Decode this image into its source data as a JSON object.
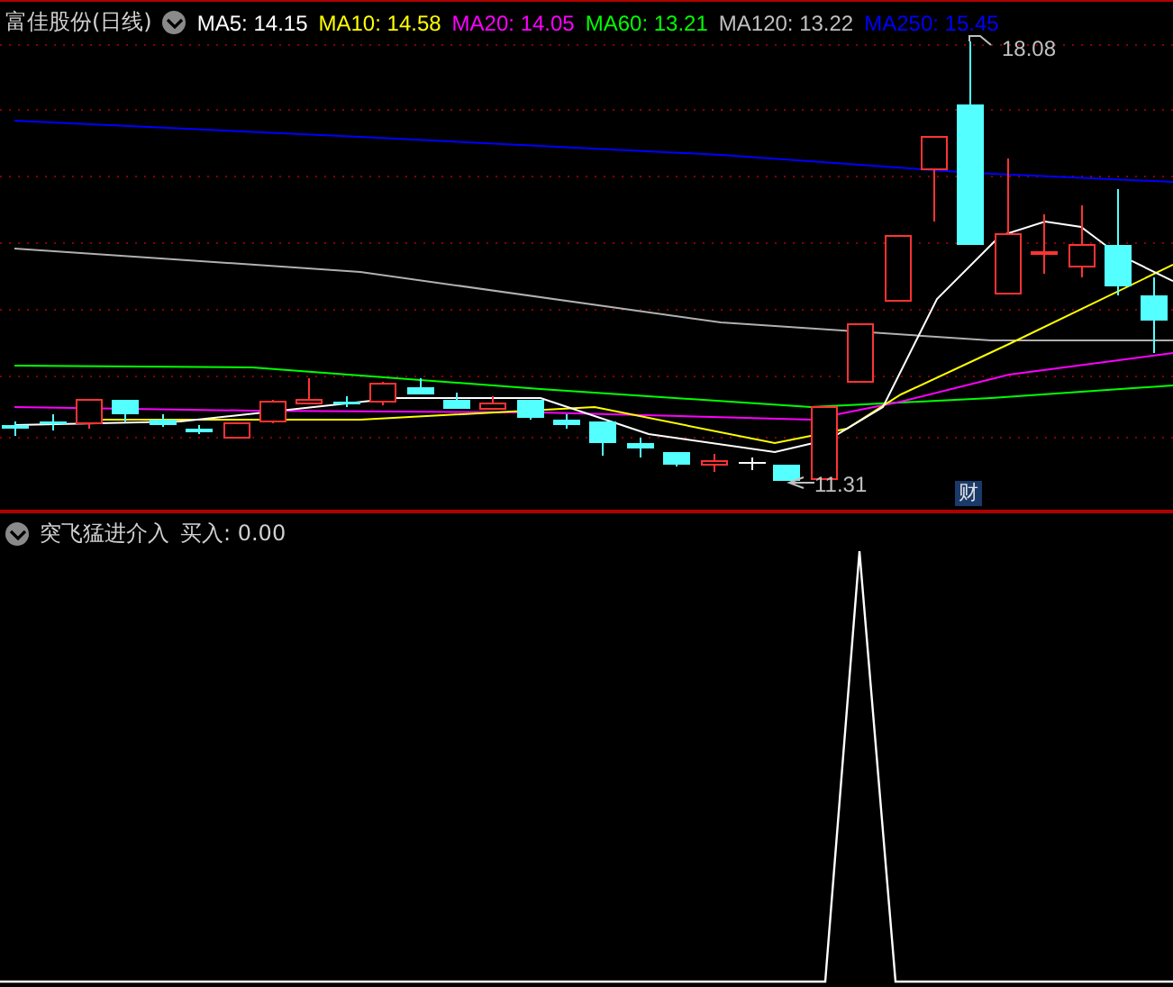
{
  "main_chart": {
    "title": "富佳股份(日线)",
    "moving_averages": [
      {
        "label": "MA5:",
        "value": "14.15",
        "color": "#ffffff"
      },
      {
        "label": "MA10:",
        "value": "14.58",
        "color": "#ffff00"
      },
      {
        "label": "MA20:",
        "value": "14.05",
        "color": "#ff00ff"
      },
      {
        "label": "MA60:",
        "value": "13.21",
        "color": "#00ff00"
      },
      {
        "label": "MA120:",
        "value": "13.22",
        "color": "#c0c0c0"
      },
      {
        "label": "MA250:",
        "value": "15.45",
        "color": "#0000ff"
      }
    ],
    "high_label": "18.08",
    "low_label": "11.31",
    "finance_marker": "财"
  },
  "indicator": {
    "name": "突飞猛进介入",
    "reading_label": "买入:",
    "reading_value": "0.00"
  }
}
